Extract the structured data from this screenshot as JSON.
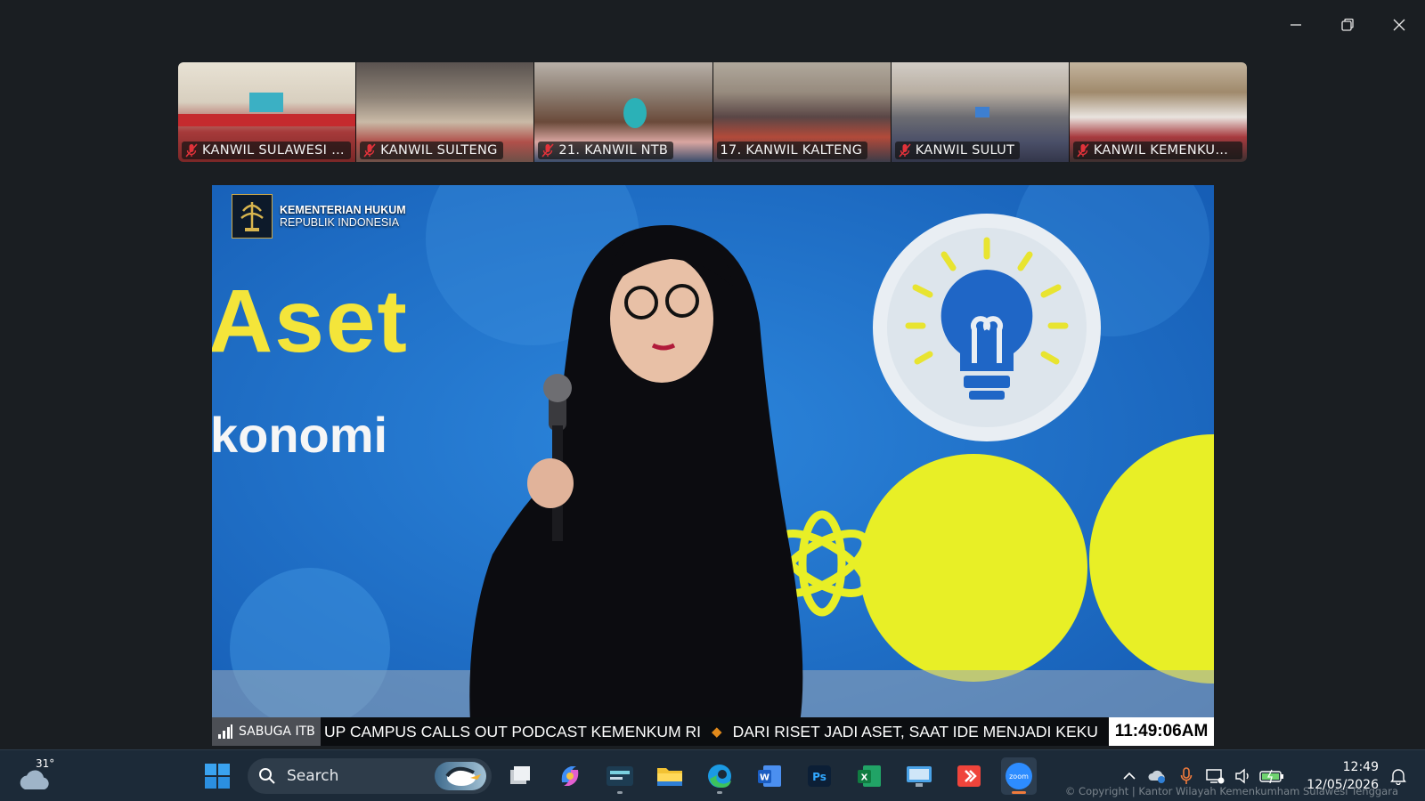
{
  "window": {
    "controls": [
      "minimize",
      "restore",
      "close"
    ]
  },
  "participants": [
    {
      "name": "KANWIL SULAWESI TE...",
      "muted": true
    },
    {
      "name": "KANWIL SULTENG",
      "muted": true
    },
    {
      "name": "21. KANWIL NTB",
      "muted": true
    },
    {
      "name": "17. KANWIL KALTENG",
      "muted": false
    },
    {
      "name": "KANWIL SULUT",
      "muted": true
    },
    {
      "name": "KANWIL KEMENKUM ...",
      "muted": true
    }
  ],
  "stage": {
    "logo_line1": "KEMENTERIAN HUKUM",
    "logo_line2": "REPUBLIK INDONESIA",
    "backdrop_word1": "Aset",
    "backdrop_word2": "konomi"
  },
  "ticker": {
    "location": "SABUGA ITB",
    "headline1": "UP CAMPUS CALLS OUT PODCAST KEMENKUM RI",
    "separator": "◆",
    "headline2": "DARI RISET JADI ASET, SAAT IDE MENJADI KEKU",
    "time": "11:49:06AM"
  },
  "taskbar": {
    "weather_temp": "31°",
    "search_placeholder": "Search",
    "apps": [
      "task-view",
      "copilot",
      "media-app",
      "file-explorer",
      "edge",
      "word",
      "photoshop",
      "excel",
      "remote-desktop",
      "anydesk",
      "zoom"
    ],
    "active_app": "zoom",
    "time": "12:49",
    "date": "12/05/2026"
  },
  "copyright": "© Copyright | Kantor Wilayah Kemenkumham Sulawesi Tenggara",
  "colors": {
    "background": "#1a1e22",
    "stage_blue": "#1f6fc8",
    "yellow": "#f4e53a",
    "mute_red": "#e0323a",
    "zoom_blue": "#2d8cff",
    "taskbar": "#1c2a38"
  }
}
